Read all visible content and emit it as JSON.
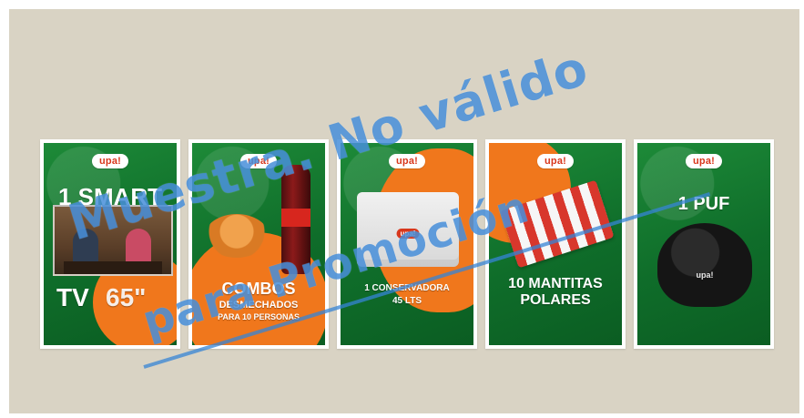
{
  "brand": {
    "logo_text": "upa!",
    "accent": "#f0771c",
    "green": "#1d8a38"
  },
  "cards": [
    {
      "headline_top": "1 SMART",
      "headline_bottom": "TV",
      "extra": "65\""
    },
    {
      "headline_top": "COMBOS",
      "headline_mid": "DESMECHADOS",
      "headline_bottom": "PARA 10 PERSONAS"
    },
    {
      "headline_top": "1 CONSERVADORA",
      "headline_bottom": "45 LTS"
    },
    {
      "headline_top": "10 MANTITAS",
      "headline_bottom": "POLARES"
    },
    {
      "headline_top": "1 PUF",
      "logo_on_item": "upa!"
    }
  ],
  "watermark": {
    "line1": "Muestra. No válido",
    "line2": "para Promoción",
    "color": "#3684d6"
  }
}
